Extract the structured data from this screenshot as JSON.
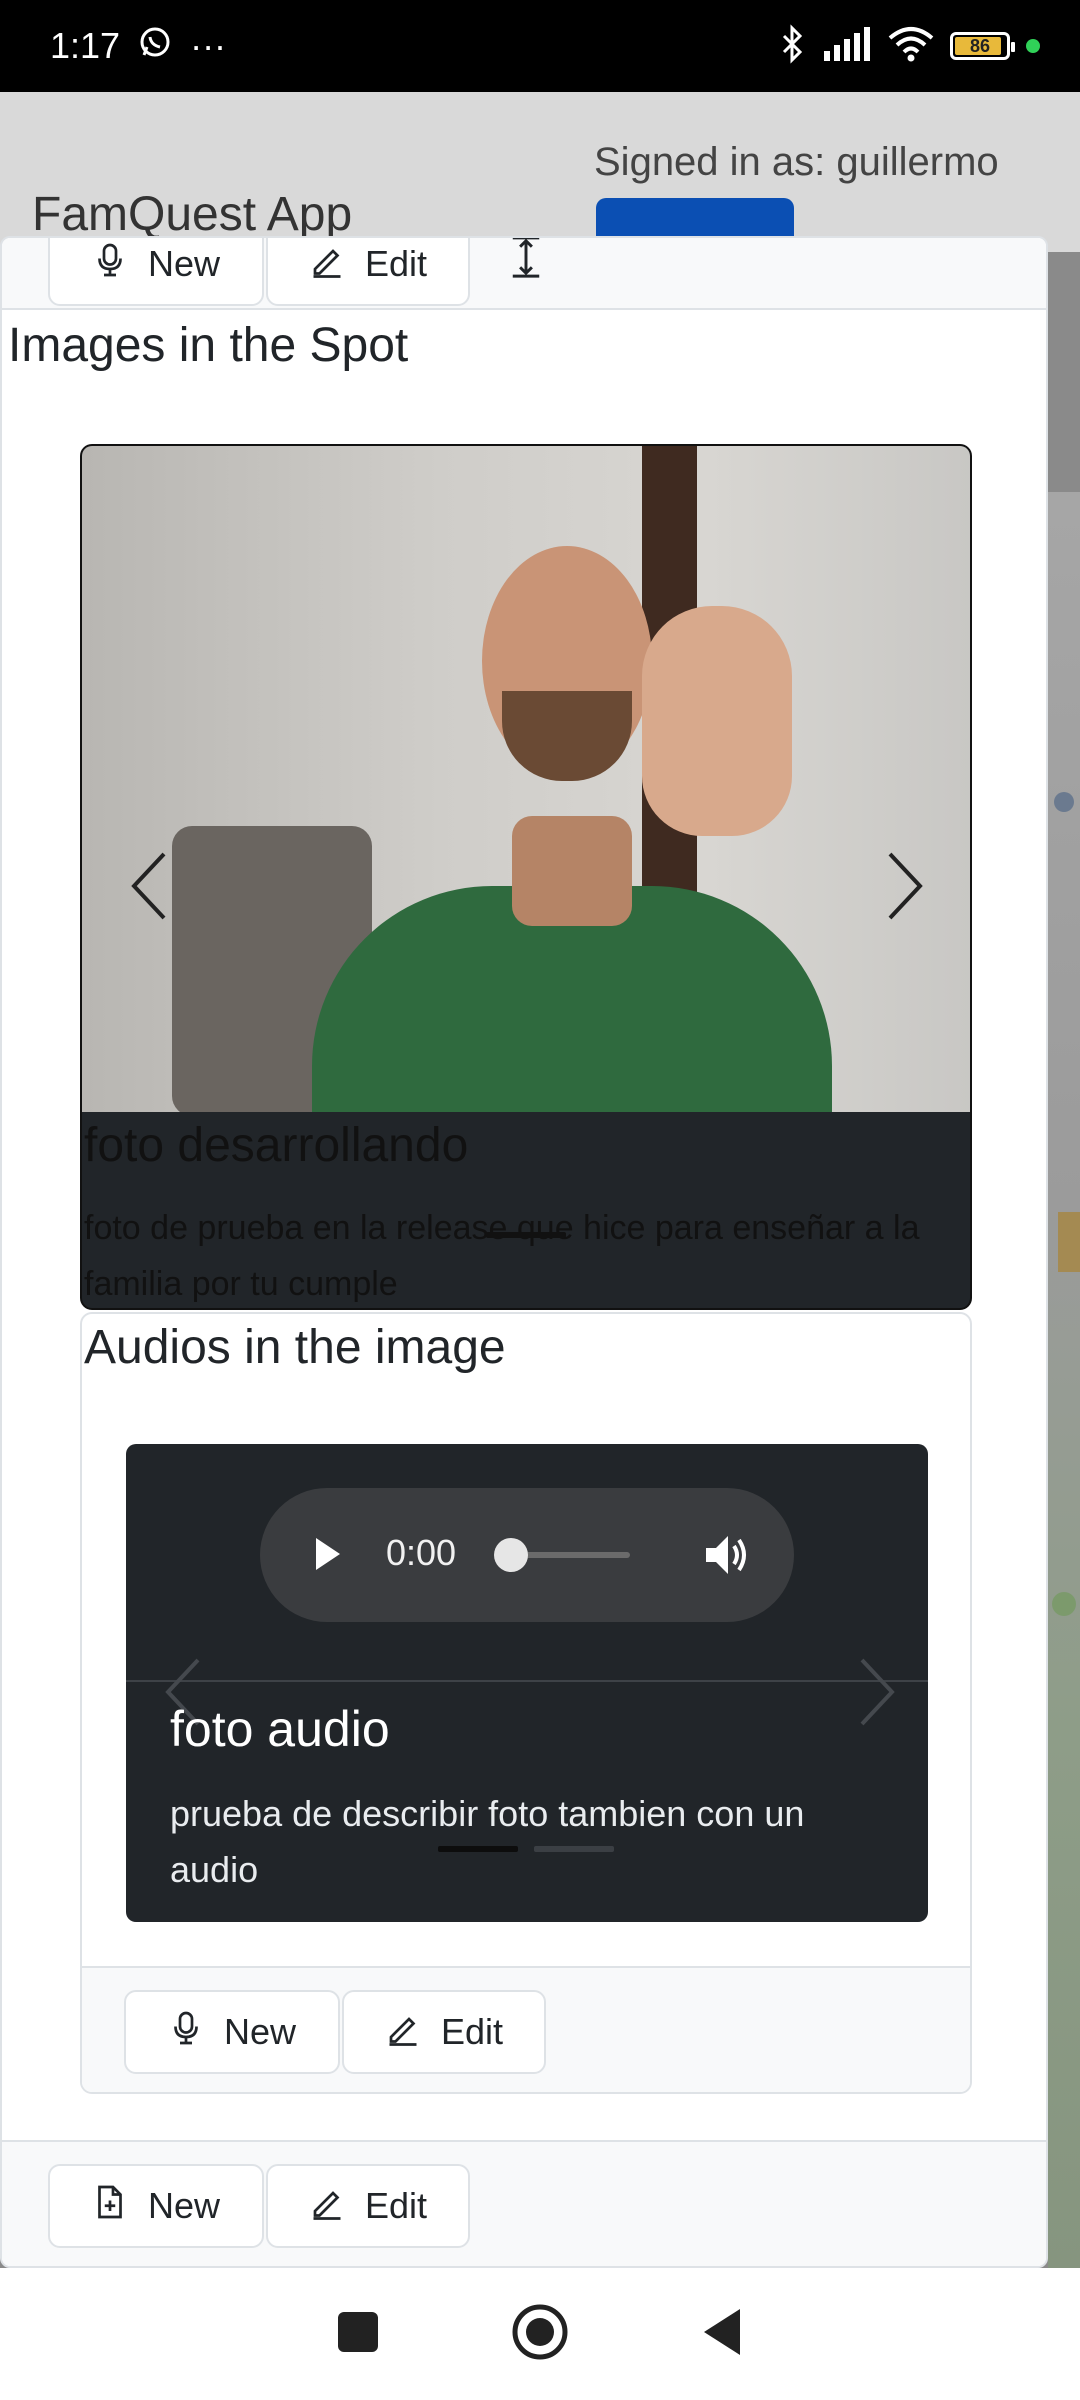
{
  "status_bar": {
    "time": "1:17",
    "more": "···",
    "battery": "86"
  },
  "app": {
    "brand": "FamQuest App",
    "signed_in": "Signed in as: guillermo"
  },
  "top_footer": {
    "new_label": "New",
    "edit_label": "Edit"
  },
  "images_section": {
    "title": "Images in the Spot",
    "slide": {
      "title": "foto desarrollando",
      "description": "foto de prueba en la release que hice para enseñar a la familia por tu cumple"
    }
  },
  "audios_section": {
    "title": "Audios in the image",
    "player": {
      "time": "0:00"
    },
    "slide": {
      "title": "foto audio",
      "description": "prueba de describir foto tambien con un audio"
    },
    "footer": {
      "new_label": "New",
      "edit_label": "Edit"
    }
  },
  "bottom_footer": {
    "new_label": "New",
    "edit_label": "Edit"
  },
  "colors": {
    "primary": "#0b4fb3",
    "dark": "#212529",
    "footer_bg": "#f8f9fa",
    "border": "#dee2e6"
  }
}
